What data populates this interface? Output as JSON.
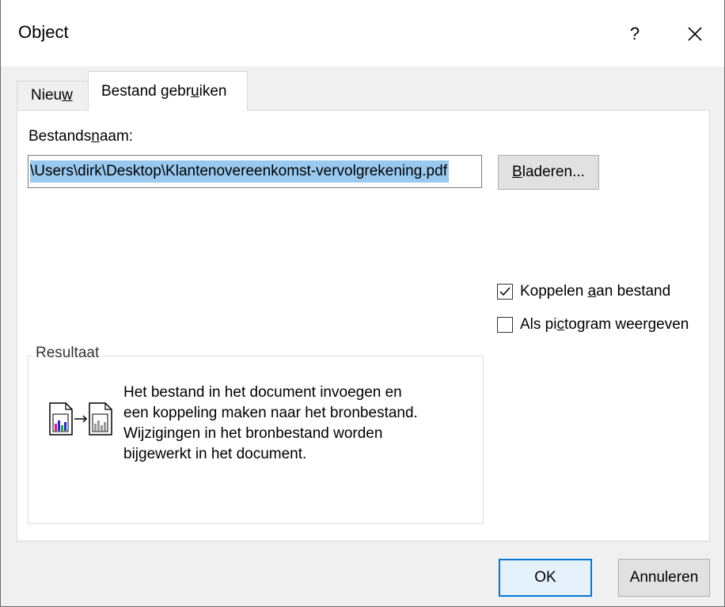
{
  "dialog": {
    "title": "Object",
    "help_label": "?",
    "close_icon": "close-icon"
  },
  "tabs": [
    {
      "label_pre": "Nieu",
      "label_acc": "w",
      "label_post": "",
      "active": false
    },
    {
      "label_pre": "Bestand gebr",
      "label_acc": "u",
      "label_post": "iken",
      "active": true
    }
  ],
  "file": {
    "label_pre": "Bestands",
    "label_acc": "n",
    "label_post": "aam:",
    "value": "\\Users\\dirk\\Desktop\\Klantenovereenkomst-vervolgrekening.pdf",
    "browse_acc": "B",
    "browse_post": "laderen..."
  },
  "options": {
    "link": {
      "pre": "Koppelen ",
      "acc": "a",
      "post": "an bestand",
      "checked": true
    },
    "icon": {
      "pre": "Als pi",
      "acc": "c",
      "post": "togram weergeven",
      "checked": false
    }
  },
  "result": {
    "legend": "Resultaat",
    "lines": [
      "Het bestand in het document invoegen en",
      "een koppeling maken naar het bronbestand.",
      "Wijzigingen in het bronbestand worden",
      "bijgewerkt in het document."
    ],
    "icon": "linked-file-icon"
  },
  "buttons": {
    "ok": "OK",
    "cancel": "Annuleren"
  },
  "colors": {
    "accent": "#0078d7",
    "selection": "#99c9ef"
  }
}
